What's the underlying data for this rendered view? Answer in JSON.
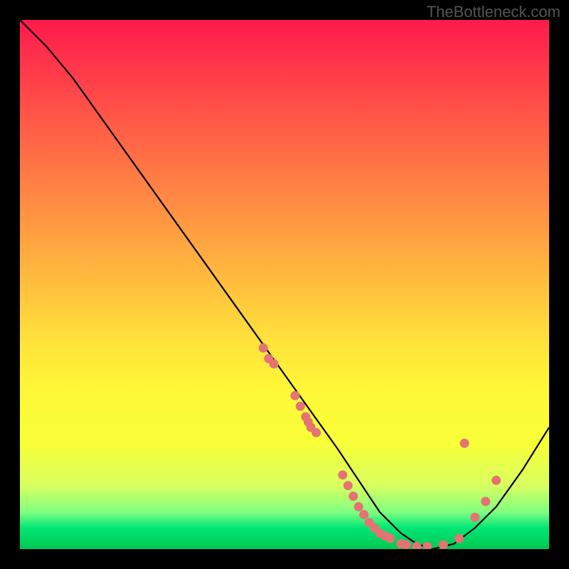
{
  "watermark": "TheBottleneck.com",
  "chart_data": {
    "type": "line",
    "title": "",
    "xlabel": "",
    "ylabel": "",
    "xlim": [
      0,
      100
    ],
    "ylim": [
      0,
      100
    ],
    "curve": {
      "x": [
        0,
        5,
        10,
        15,
        20,
        25,
        30,
        35,
        40,
        45,
        50,
        55,
        60,
        62,
        64,
        66,
        68,
        70,
        72,
        75,
        78,
        82,
        86,
        90,
        95,
        100
      ],
      "y": [
        100,
        95,
        89,
        82,
        75,
        68,
        61,
        54,
        47,
        40,
        33,
        26,
        19,
        16,
        13,
        10,
        7,
        5,
        3,
        1,
        0,
        1,
        4,
        8,
        15,
        23
      ]
    },
    "scatter_points": [
      {
        "x": 46,
        "y": 38
      },
      {
        "x": 47,
        "y": 36
      },
      {
        "x": 48,
        "y": 35
      },
      {
        "x": 52,
        "y": 29
      },
      {
        "x": 53,
        "y": 27
      },
      {
        "x": 54,
        "y": 25
      },
      {
        "x": 54.5,
        "y": 24
      },
      {
        "x": 55,
        "y": 23
      },
      {
        "x": 56,
        "y": 22
      },
      {
        "x": 61,
        "y": 14
      },
      {
        "x": 62,
        "y": 12
      },
      {
        "x": 63,
        "y": 10
      },
      {
        "x": 64,
        "y": 8
      },
      {
        "x": 65,
        "y": 6.5
      },
      {
        "x": 66,
        "y": 5
      },
      {
        "x": 67,
        "y": 4
      },
      {
        "x": 68,
        "y": 3
      },
      {
        "x": 69,
        "y": 2.5
      },
      {
        "x": 70,
        "y": 2
      },
      {
        "x": 72,
        "y": 1
      },
      {
        "x": 73,
        "y": 0.8
      },
      {
        "x": 75,
        "y": 0.5
      },
      {
        "x": 77,
        "y": 0.5
      },
      {
        "x": 80,
        "y": 0.8
      },
      {
        "x": 83,
        "y": 2
      },
      {
        "x": 86,
        "y": 6
      },
      {
        "x": 88,
        "y": 9
      },
      {
        "x": 90,
        "y": 13
      },
      {
        "x": 84,
        "y": 20
      }
    ],
    "colors": {
      "curve": "#000000",
      "points": "#e57373",
      "background_top": "#ff1a4d",
      "background_bottom": "#00c853"
    }
  }
}
